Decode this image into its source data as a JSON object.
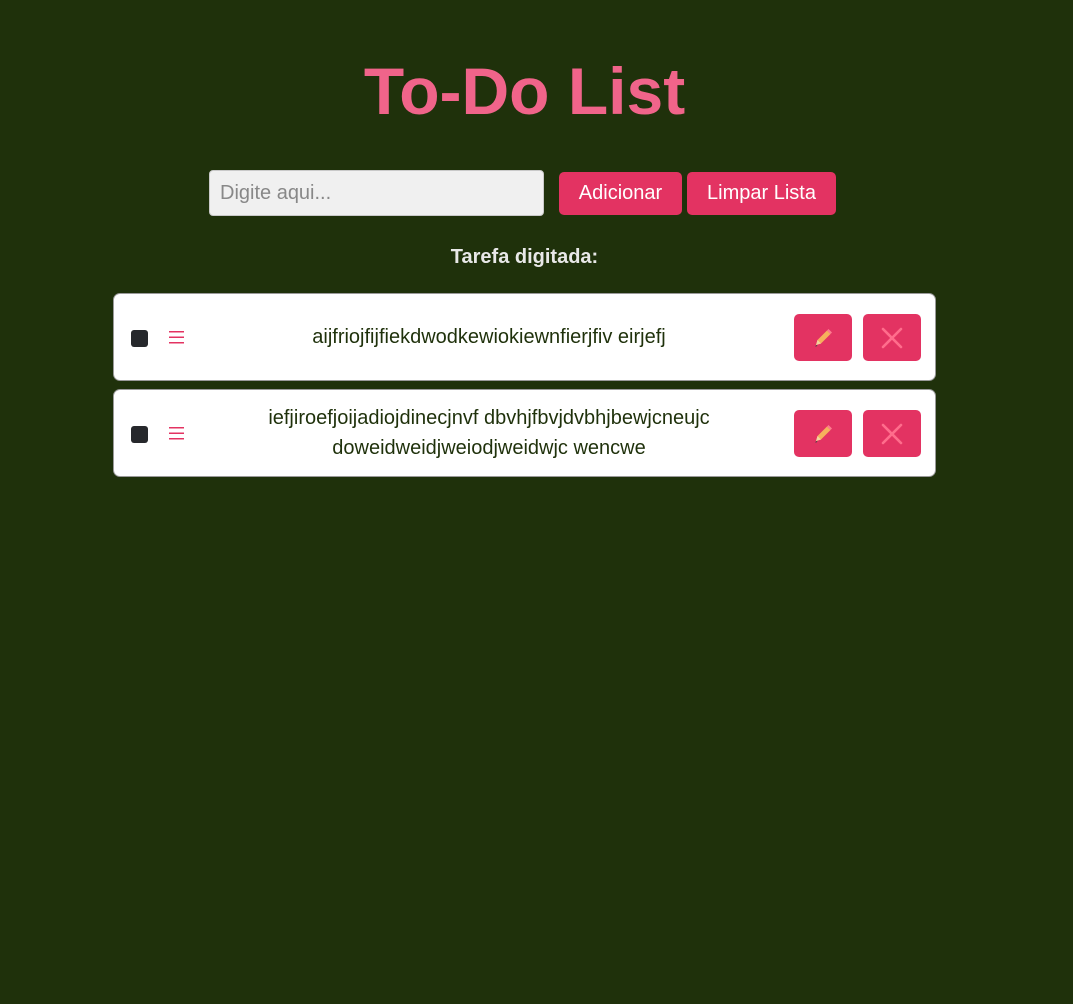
{
  "header": {
    "title": "To-Do List"
  },
  "form": {
    "input_placeholder": "Digite aqui...",
    "input_value": "",
    "add_label": "Adicionar",
    "clear_label": "Limpar Lista"
  },
  "section": {
    "subtitle": "Tarefa digitada:"
  },
  "tasks": [
    {
      "text": "aijfriojfijfiekdwodkewiokiewnfierjfiv eirjefj",
      "checked": false
    },
    {
      "text": "iefjiroefjoijadiojdinecjnvf dbvhjfbvjdvbhjbewjcneujc doweidweidjweiodjweidwjc wencwe",
      "checked": false
    }
  ],
  "icons": {
    "drag": "drag-handle-icon",
    "edit": "pencil-icon",
    "delete": "close-icon"
  },
  "colors": {
    "background": "#1f310b",
    "accent": "#e33362",
    "title": "#f0648a",
    "card": "#ffffff"
  }
}
